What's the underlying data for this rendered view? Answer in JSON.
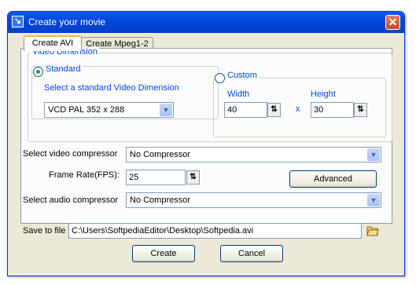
{
  "window": {
    "title": "Create your movie",
    "close_glyph": "✕",
    "icon": "app-icon"
  },
  "tabs": [
    {
      "label": "Create AVI",
      "active": true
    },
    {
      "label": "Create Mpeg1-2",
      "active": false
    }
  ],
  "video_dimension": {
    "legend": "Video Dimension",
    "standard": {
      "label": "Standard",
      "selected": true,
      "caption": "Select a standard Video Dimension",
      "value": "VCD PAL 352 x 288"
    },
    "custom": {
      "label": "Custom",
      "selected": false,
      "width_label": "Width",
      "width_value": "40",
      "height_label": "Height",
      "height_value": "30",
      "times": "x"
    }
  },
  "video_compressor": {
    "label": "Select video compressor",
    "value": "No Compressor"
  },
  "frame_rate": {
    "label": "Frame Rate(FPS):",
    "value": "25"
  },
  "advanced_button": "Advanced",
  "audio_compressor": {
    "label": "Select audio compressor",
    "value": "No Compressor"
  },
  "save": {
    "label": "Save to file",
    "value": "C:\\Users\\SoftpediaEditor\\Desktop\\Softpedia.avi"
  },
  "buttons": {
    "create": "Create",
    "cancel": "Cancel"
  },
  "glyphs": {
    "dropdown": "▼",
    "spin": "⇅"
  },
  "colors": {
    "title_bar": "#0147d6",
    "accent_blue": "#0046d5",
    "tab_highlight": "#f5b53c",
    "close": "#c94a26"
  }
}
